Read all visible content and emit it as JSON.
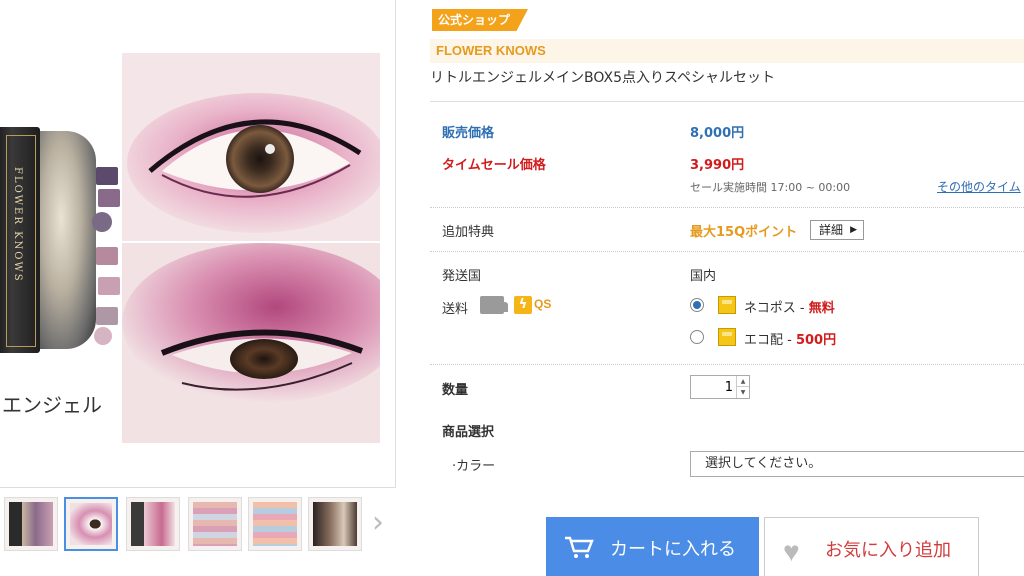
{
  "gallery": {
    "caption": "エンジェル",
    "thumbnails": [
      "palette-thumb",
      "eye-thumb",
      "palette-eye-thumb",
      "swatch-thumb",
      "swatch-thumb-2",
      "store-thumb"
    ],
    "active_index": 1
  },
  "product": {
    "shop_badge": "公式ショップ",
    "brand": "FLOWER KNOWS",
    "title": "リトルエンジェルメインBOX5点入りスペシャルセット"
  },
  "pricing": {
    "sale_label": "販売価格",
    "sale_price": "8,000円",
    "timesale_label": "タイムセール価格",
    "timesale_price": "3,990円",
    "timesale_period": "セール実施時間 17:00 ~ 00:00",
    "other_timesale_link": "その他のタイム"
  },
  "bonus": {
    "label": "追加特典",
    "value": "最大15Qポイント",
    "detail_button": "詳細"
  },
  "shipping": {
    "origin_label": "発送国",
    "origin_value": "国内",
    "fee_label": "送料",
    "qs_label": "QS",
    "options": [
      {
        "name": "ネコポス - ",
        "price": "無料",
        "selected": true
      },
      {
        "name": "エコ配 - ",
        "price": "500円",
        "selected": false
      }
    ]
  },
  "quantity": {
    "label": "数量",
    "value": "1"
  },
  "selection": {
    "label": "商品選択",
    "color_label": "·カラー",
    "color_placeholder": "選択してください。"
  },
  "actions": {
    "cart_button": "カートに入れる",
    "favorite_button": "お気に入り追加"
  },
  "colors": {
    "accent_blue": "#4b8de6",
    "price_red": "#d21b1b",
    "brand_orange": "#e69a1e"
  }
}
